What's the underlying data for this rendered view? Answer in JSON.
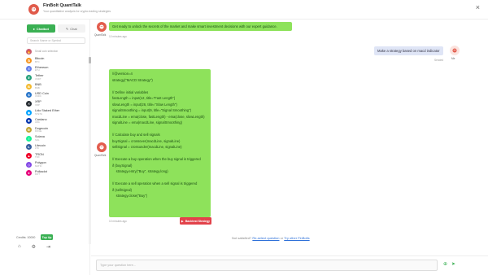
{
  "header": {
    "title": "FinBolt QuantTalk",
    "subtitle": "Your quantitative analysis for crypto-trading strategies"
  },
  "sidebar": {
    "tabs": [
      {
        "label": "Chatbot",
        "active": true
      },
      {
        "label": "Chat",
        "active": false
      }
    ],
    "search_placeholder": "Search Name or Symbol",
    "coins": [
      {
        "name": "Small coin selection",
        "symbol": "",
        "color": "#c95f73",
        "icon": "🔥"
      },
      {
        "name": "Bitcoin",
        "symbol": "BTC",
        "color": "#f7931a",
        "icon": "₿"
      },
      {
        "name": "Ethereum",
        "symbol": "ETH",
        "color": "#627eea",
        "icon": "Ξ"
      },
      {
        "name": "Tether",
        "symbol": "USDT",
        "color": "#26a17b",
        "icon": "₮"
      },
      {
        "name": "BNB",
        "symbol": "BNB",
        "color": "#f3ba2f",
        "icon": "B"
      },
      {
        "name": "USD Coin",
        "symbol": "USDC",
        "color": "#2775ca",
        "icon": "$"
      },
      {
        "name": "XRP",
        "symbol": "XRP",
        "color": "#23292f",
        "icon": "✕"
      },
      {
        "name": "Lido Staked Ether",
        "symbol": "STETH",
        "color": "#00a3ff",
        "icon": "◆"
      },
      {
        "name": "Cardano",
        "symbol": "ADA",
        "color": "#0033ad",
        "icon": "✺"
      },
      {
        "name": "Dogecoin",
        "symbol": "DOGE",
        "color": "#c2a633",
        "icon": "Ð"
      },
      {
        "name": "Solana",
        "symbol": "SOL",
        "color": "#14f195",
        "icon": "≡"
      },
      {
        "name": "Litecoin",
        "symbol": "LTC",
        "color": "#345d9d",
        "icon": "Ł"
      },
      {
        "name": "TRON",
        "symbol": "TRX",
        "color": "#ef0027",
        "icon": "▲"
      },
      {
        "name": "Polygon",
        "symbol": "MATIC",
        "color": "#8247e5",
        "icon": "◇"
      },
      {
        "name": "Polkadot",
        "symbol": "DOT",
        "color": "#e6007a",
        "icon": "●"
      }
    ],
    "credits_label": "Credits: 10000",
    "topup_label": "Top Up"
  },
  "chat": {
    "bot_label": "QuantTalk",
    "user_label": "Me",
    "welcome": "Get ready to unlock the secrets of the market and make smart investment decisions with our expert guidance.",
    "welcome_time": "10 minutes ago",
    "user_message": "Make a strategy based on macd indicator",
    "user_status": "Sended",
    "code_lines": [
      "//@version=4",
      "strategy(\"MACD Strategy\")",
      "",
      "// Define initial variables",
      "fastLength = input(12, title=\"Fast Length\")",
      "slowLength = input(26, title=\"Slow Length\")",
      "signalSmoothing = input(9, title=\"Signal Smoothing\")",
      "macdLine = ema(close, fastLength) - ema(close, slowLength)",
      "signalLine = ema(macdLine, signalSmoothing)",
      "",
      "// Calculate buy and sell signals",
      "buySignal = crossover(macdLine, signalLine)",
      "sellSignal = crossunder(macdLine, signalLine)",
      "",
      "// Execute a buy operation when the buy signal is triggered",
      "if (buySignal)",
      "    strategy.entry(\"Buy\", strategy.long)",
      "",
      "// Execute a sell operation when a sell signal is triggered",
      "if (sellSignal)",
      "    strategy.close(\"Buy\")"
    ],
    "code_time": "10 minutes ago",
    "backtest_label": "Backtest Strategy",
    "not_satisfied": "Not satisfied?",
    "link_select": "Re-select question",
    "link_or": "or",
    "link_other": "Try other FinBolts"
  },
  "input": {
    "placeholder": "Type your question here..."
  }
}
